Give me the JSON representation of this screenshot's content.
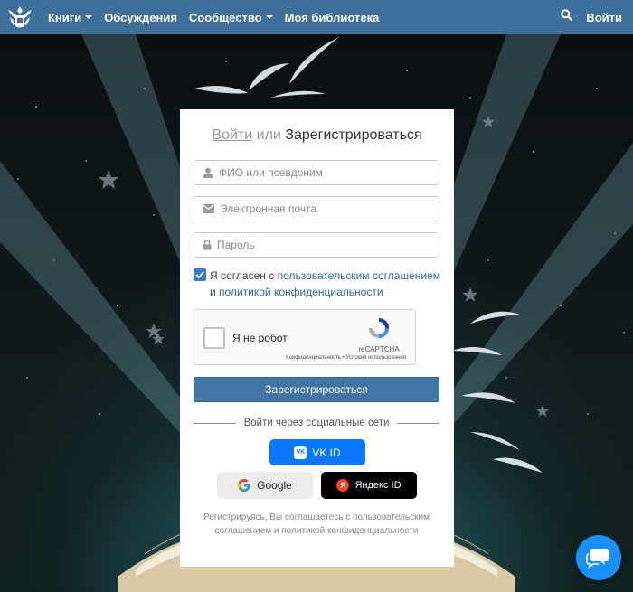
{
  "nav": {
    "items": [
      {
        "label": "Книги",
        "dropdown": true
      },
      {
        "label": "Обсуждения",
        "dropdown": false
      },
      {
        "label": "Сообщество",
        "dropdown": true
      },
      {
        "label": "Моя библиотека",
        "dropdown": false
      }
    ],
    "login_label": "Войти",
    "icons": {
      "logo": "site-logo",
      "search": "search-icon"
    },
    "bar_color": "#3f6f9b"
  },
  "form": {
    "tab_login": "Войти",
    "or": "или",
    "tab_register": "Зарегистрироваться",
    "fields": {
      "name": {
        "placeholder": "ФИО или псевдоним",
        "value": "",
        "icon": "user-icon"
      },
      "email": {
        "placeholder": "Электронная почта",
        "value": "",
        "icon": "envelope-icon"
      },
      "password": {
        "placeholder": "Пароль",
        "value": "",
        "icon": "lock-icon"
      }
    },
    "agree": {
      "checked": true,
      "prefix": "Я согласен с ",
      "link1": "пользовательским соглашением",
      "middle": " и ",
      "link2": "политикой конфиденциальности"
    },
    "captcha": {
      "label": "Я не робот",
      "brand": "reCAPTCHA",
      "terms": "Конфиденциальность • Условия использования"
    },
    "submit_label": "Зарегистрироваться",
    "social_divider": "Войти через социальные сети",
    "social": {
      "vk": "VK ID",
      "google": "Google",
      "yandex": "Яндекс ID"
    },
    "footnote": "Регистрируясь, Вы соглашаетесь с пользовательским соглашением и политикой конфиденциальности",
    "accent_color": "#4274a6"
  },
  "chat": {
    "icon": "chat-icon",
    "color": "#1a90ff"
  }
}
